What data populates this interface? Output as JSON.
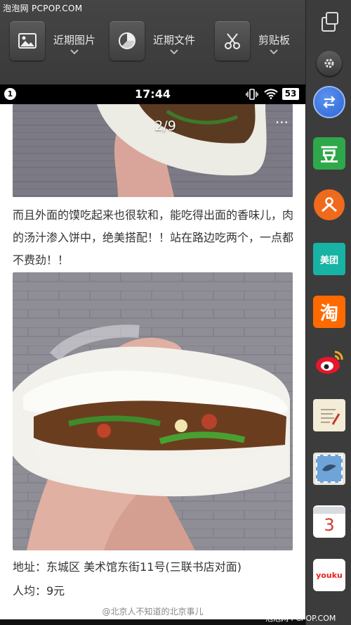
{
  "watermark": "泡泡网 PCPOP.COM",
  "watermark_bottom": "泡泡网 PCPOP.COM",
  "toolbar": {
    "items": [
      {
        "label": "近期图片",
        "icon": "image-icon"
      },
      {
        "label": "近期文件",
        "icon": "pie-chart-icon"
      },
      {
        "label": "剪贴板",
        "icon": "scissors-icon"
      }
    ]
  },
  "status": {
    "notification_count": "1",
    "time": "17:44",
    "battery": "53"
  },
  "article": {
    "pager": "2/9",
    "more": "···",
    "paragraph": "而且外面的馍吃起来也很软和，能吃得出面的香味儿，肉的汤汁渗入饼中，绝美搭配！！站在路边吃两个，一点都不费劲！！",
    "address": "地址：东城区 美术馆东街11号(三联书店对面)",
    "price": "人均：9元",
    "credit": "@北京人不知道的北京事儿"
  },
  "sidebar": {
    "apps": [
      {
        "name": "switch-icon",
        "label": ""
      },
      {
        "name": "douban-icon",
        "label": "豆"
      },
      {
        "name": "app-orange-icon",
        "label": ""
      },
      {
        "name": "meituan-icon",
        "label": "美团"
      },
      {
        "name": "taobao-icon",
        "label": "淘"
      },
      {
        "name": "weibo-icon",
        "label": ""
      },
      {
        "name": "notes-icon",
        "label": ""
      },
      {
        "name": "mail-stamp-icon",
        "label": ""
      },
      {
        "name": "calendar-icon",
        "label": "3"
      },
      {
        "name": "youku-icon",
        "label": "youku"
      }
    ]
  },
  "colors": {
    "douban": "#2ea84a",
    "orange": "#f06a1c",
    "meituan": "#17b3a4",
    "taobao": "#ff6a00",
    "blue": "#2b66d6"
  }
}
